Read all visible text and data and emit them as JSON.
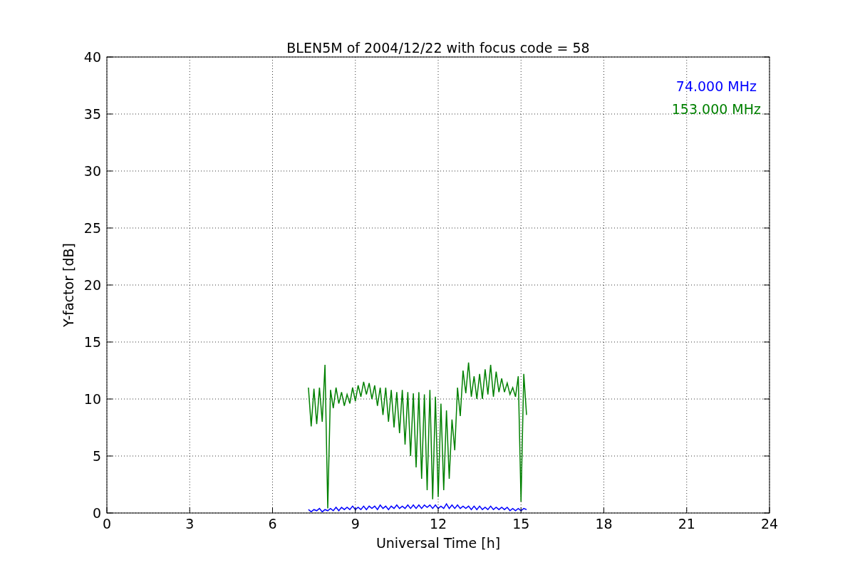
{
  "figure": {
    "chart_data": {
      "type": "line",
      "title": "BLEN5M of 2004/12/22 with focus code = 58",
      "xlabel": "Universal Time [h]",
      "ylabel": "Y-factor [dB]",
      "grid": true,
      "xlim": [
        0,
        24
      ],
      "ylim": [
        0,
        40
      ],
      "xticks": [
        0,
        3,
        6,
        9,
        12,
        15,
        18,
        21,
        24
      ],
      "yticks": [
        0,
        5,
        10,
        15,
        20,
        25,
        30,
        35,
        40
      ],
      "x": [
        7.3,
        7.4,
        7.5,
        7.6,
        7.7,
        7.8,
        7.9,
        8.0,
        8.1,
        8.2,
        8.3,
        8.4,
        8.5,
        8.6,
        8.7,
        8.8,
        8.9,
        9.0,
        9.1,
        9.2,
        9.3,
        9.4,
        9.5,
        9.6,
        9.7,
        9.8,
        9.9,
        10.0,
        10.1,
        10.2,
        10.3,
        10.4,
        10.5,
        10.6,
        10.7,
        10.8,
        10.9,
        11.0,
        11.1,
        11.2,
        11.3,
        11.4,
        11.5,
        11.6,
        11.7,
        11.8,
        11.9,
        12.0,
        12.1,
        12.2,
        12.3,
        12.4,
        12.5,
        12.6,
        12.7,
        12.8,
        12.9,
        13.0,
        13.1,
        13.2,
        13.3,
        13.4,
        13.5,
        13.6,
        13.7,
        13.8,
        13.9,
        14.0,
        14.1,
        14.2,
        14.3,
        14.4,
        14.5,
        14.6,
        14.7,
        14.8,
        14.9,
        15.0,
        15.1,
        15.2
      ],
      "series": [
        {
          "name": "74.000 MHz",
          "color": "#0000ff",
          "values": [
            0.3,
            0.1,
            0.3,
            0.2,
            0.4,
            0.1,
            0.3,
            0.2,
            0.4,
            0.2,
            0.5,
            0.2,
            0.5,
            0.3,
            0.5,
            0.3,
            0.6,
            0.3,
            0.5,
            0.3,
            0.6,
            0.3,
            0.6,
            0.4,
            0.6,
            0.3,
            0.7,
            0.4,
            0.6,
            0.3,
            0.6,
            0.4,
            0.7,
            0.4,
            0.6,
            0.4,
            0.7,
            0.4,
            0.7,
            0.4,
            0.7,
            0.4,
            0.7,
            0.5,
            0.7,
            0.4,
            0.7,
            0.4,
            0.6,
            0.4,
            0.8,
            0.4,
            0.7,
            0.4,
            0.7,
            0.4,
            0.6,
            0.4,
            0.6,
            0.3,
            0.6,
            0.3,
            0.6,
            0.3,
            0.5,
            0.3,
            0.6,
            0.3,
            0.5,
            0.3,
            0.5,
            0.3,
            0.5,
            0.2,
            0.4,
            0.2,
            0.4,
            0.2,
            0.4,
            0.3
          ]
        },
        {
          "name": "153.000 MHz",
          "color": "#008000",
          "values": [
            11,
            7.6,
            10.9,
            7.8,
            11,
            8,
            13,
            0.4,
            10.8,
            9.2,
            11,
            9.6,
            10.6,
            9.4,
            10.4,
            9.6,
            11,
            9.8,
            11.2,
            10.2,
            11.5,
            10.4,
            11.4,
            10,
            11.2,
            9.4,
            11,
            8.6,
            11,
            8,
            10.8,
            7.5,
            10.6,
            7,
            10.8,
            6,
            10.6,
            5,
            10.5,
            4,
            10.6,
            3,
            10.4,
            2,
            10.8,
            1.2,
            10.2,
            1.4,
            9.6,
            2,
            9,
            3,
            8.2,
            5.5,
            11,
            8.5,
            12.5,
            10.5,
            13.2,
            10.2,
            12,
            10,
            12.2,
            10,
            12.6,
            10.4,
            13,
            10.2,
            12.4,
            10.6,
            11.8,
            10.6,
            11.4,
            10.4,
            11,
            10.2,
            12,
            1,
            12.2,
            8.6
          ]
        }
      ]
    }
  }
}
